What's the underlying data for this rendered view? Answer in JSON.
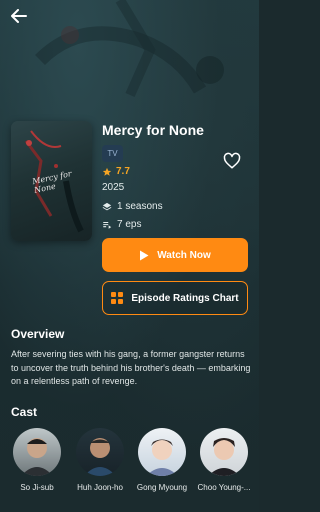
{
  "header": {
    "back_icon": "arrow-left-icon"
  },
  "show": {
    "title": "Mercy for None",
    "type_badge": "TV",
    "rating": "7.7",
    "year": "2025",
    "seasons": "1 seasons",
    "episodes": "7 eps",
    "poster_title": "Mercy for None"
  },
  "actions": {
    "watch_label": "Watch Now",
    "chart_label": "Episode Ratings Chart",
    "accent_color": "#ff8a12"
  },
  "overview": {
    "heading": "Overview",
    "text": "After severing ties with his gang, a former gangster returns to uncover the truth behind his brother's death — embarking on a relentless path of revenge."
  },
  "cast": {
    "heading": "Cast",
    "members": [
      {
        "name": "So Ji-sub"
      },
      {
        "name": "Huh Joon-ho"
      },
      {
        "name": "Gong Myoung"
      },
      {
        "name": "Choo Young-..."
      }
    ]
  }
}
